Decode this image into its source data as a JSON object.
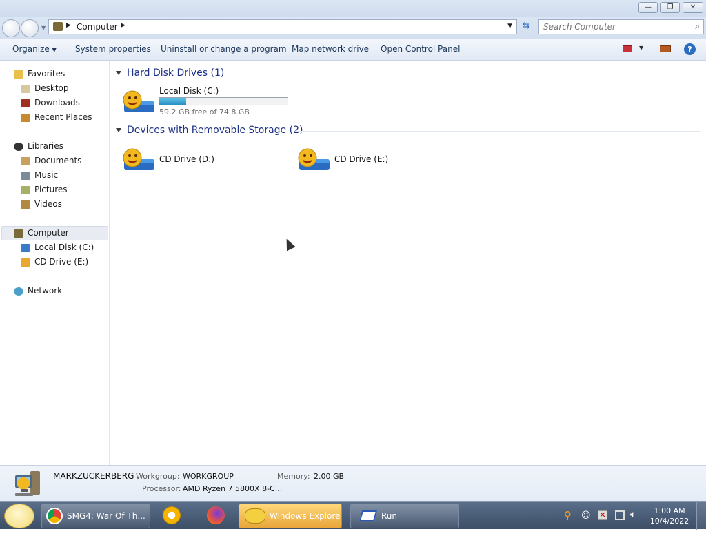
{
  "titlebar": {
    "buttons": [
      "minimize",
      "restore",
      "close"
    ]
  },
  "address": {
    "path": "Computer",
    "search_placeholder": "Search Computer"
  },
  "toolbar": {
    "items": [
      "Organize",
      "System properties",
      "Uninstall or change a program",
      "Map network drive",
      "Open Control Panel"
    ]
  },
  "sidebar": {
    "favorites": "Favorites",
    "desktop": "Desktop",
    "downloads": "Downloads",
    "recent_places": "Recent Places",
    "libraries": "Libraries",
    "documents": "Documents",
    "music": "Music",
    "pictures": "Pictures",
    "videos": "Videos",
    "computer": "Computer",
    "local_disk": "Local Disk (C:)",
    "cd_drive": "CD Drive (E:)",
    "network": "Network"
  },
  "content": {
    "hdd_group": "Hard Disk Drives (1)",
    "removable_group": "Devices with Removable Storage (2)",
    "local_disk": {
      "name": "Local Disk (C:)",
      "free": "59.2 GB free of 74.8 GB",
      "used_fraction": 0.21
    },
    "cd_d": "CD Drive (D:)",
    "cd_e": "CD Drive (E:)"
  },
  "details": {
    "computer_name": "MARKZUCKERBERG",
    "workgroup_label": "Workgroup:",
    "workgroup": "WORKGROUP",
    "memory_label": "Memory:",
    "memory": "2.00 GB",
    "processor_label": "Processor:",
    "processor": "AMD Ryzen 7 5800X 8-C..."
  },
  "taskbar": {
    "chrome_task": "SMG4: War Of Th...",
    "explorer_task": "Windows Explorer",
    "run_task": "Run",
    "time": "1:00 AM",
    "date": "10/4/2022"
  },
  "colors": {
    "accent": "#1e3287",
    "bar_fill": "#2a8fc2",
    "active_task": "#e8a53a"
  }
}
